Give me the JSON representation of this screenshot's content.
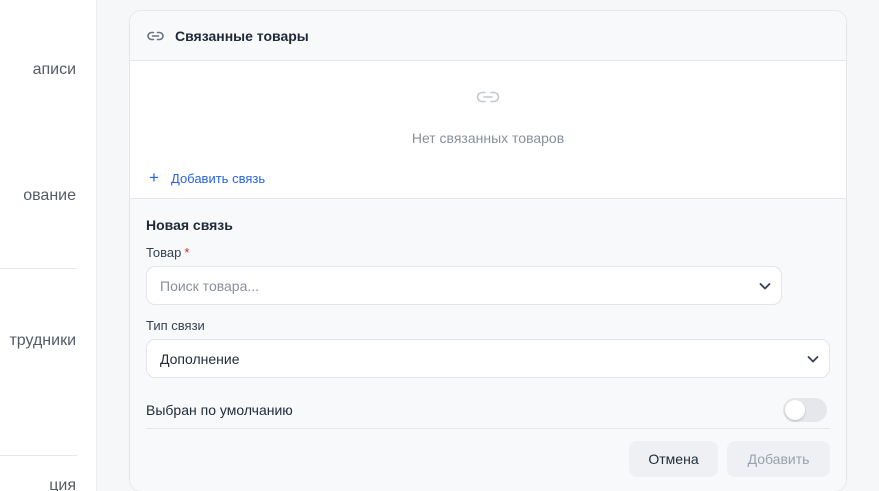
{
  "sidebar": {
    "items": [
      {
        "label": "аписи"
      },
      {
        "label": "ование"
      },
      {
        "label": "трудники"
      },
      {
        "label": "ция"
      }
    ]
  },
  "panel": {
    "icon": "link-icon",
    "title": "Связанные товары",
    "empty_icon": "link-icon",
    "empty_text": "Нет связанных товаров",
    "add_link_label": "Добавить связь"
  },
  "form": {
    "title": "Новая связь",
    "product_label": "Товар",
    "required_mark": "*",
    "product_placeholder": "Поиск товара...",
    "type_label": "Тип связи",
    "type_value": "Дополнение",
    "default_label": "Выбран по умолчанию",
    "default_on": false,
    "cancel_label": "Отмена",
    "submit_label": "Добавить"
  },
  "colors": {
    "accent": "#2563eb",
    "required": "#dc2626",
    "muted_text": "#8a909b"
  }
}
